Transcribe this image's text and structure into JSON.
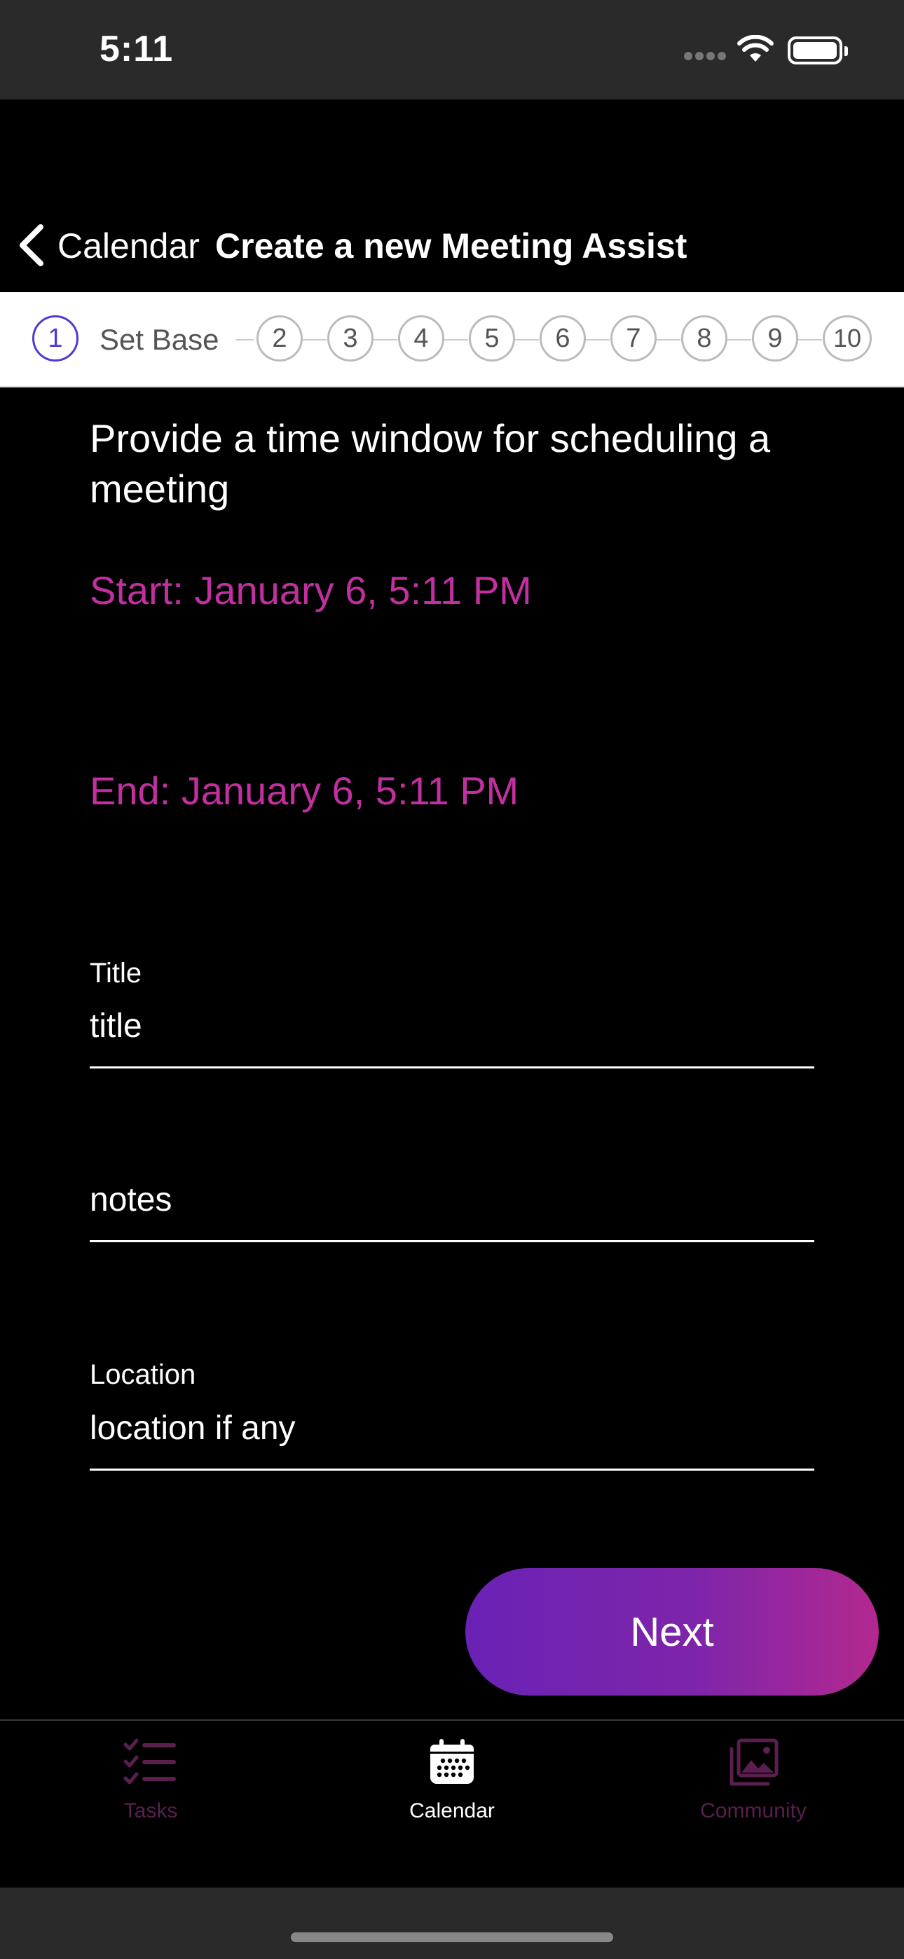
{
  "status_bar": {
    "time": "5:11"
  },
  "nav": {
    "back_label": "Calendar",
    "title": "Create a new Meeting Assist"
  },
  "stepper": {
    "current_step": "1",
    "current_label": "Set Base",
    "steps": [
      "2",
      "3",
      "4",
      "5",
      "6",
      "7",
      "8",
      "9",
      "10"
    ],
    "active_color": "#4f3bd1"
  },
  "content": {
    "instruction": "Provide a time window for scheduling a meeting",
    "start": "Start: January 6, 5:11 PM",
    "end": "End: January 6, 5:11 PM",
    "accent_color": "#c22fa0"
  },
  "form": {
    "title_label": "Title",
    "title_placeholder": "title",
    "notes_placeholder": "notes",
    "location_label": "Location",
    "location_placeholder": "location if any"
  },
  "next_button": {
    "label": "Next"
  },
  "tab_bar": {
    "tabs": [
      {
        "label": "Tasks",
        "icon": "tasks-icon"
      },
      {
        "label": "Calendar",
        "icon": "calendar-icon"
      },
      {
        "label": "Community",
        "icon": "community-icon"
      }
    ]
  }
}
